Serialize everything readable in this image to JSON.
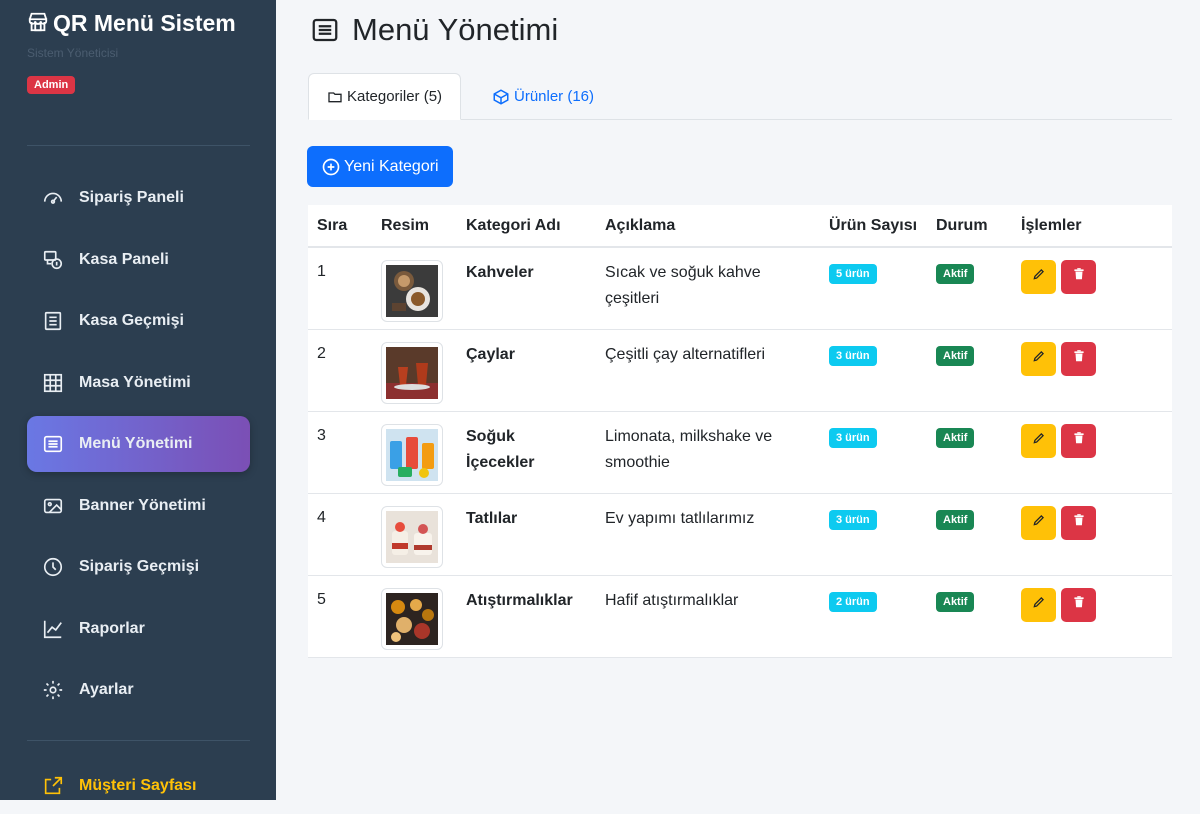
{
  "brand": {
    "title": "QR Menü Sistem",
    "subtitle": "Sistem Yöneticisi",
    "role_badge": "Admin"
  },
  "nav": [
    {
      "label": "Sipariş Paneli",
      "icon": "speedometer-icon"
    },
    {
      "label": "Kasa Paneli",
      "icon": "cash-register-icon"
    },
    {
      "label": "Kasa Geçmişi",
      "icon": "receipt-icon"
    },
    {
      "label": "Masa Yönetimi",
      "icon": "grid-icon"
    },
    {
      "label": "Menü Yönetimi",
      "icon": "list-icon",
      "active": true
    },
    {
      "label": "Banner Yönetimi",
      "icon": "image-icon"
    },
    {
      "label": "Sipariş Geçmişi",
      "icon": "clock-icon"
    },
    {
      "label": "Raporlar",
      "icon": "chart-line-icon"
    },
    {
      "label": "Ayarlar",
      "icon": "gear-icon"
    }
  ],
  "customer_link": {
    "label": "Müşteri Sayfası",
    "icon": "external-link-icon"
  },
  "page": {
    "title": "Menü Yönetimi"
  },
  "tabs": [
    {
      "label": "Kategoriler (5)",
      "icon": "folder-icon",
      "active": true
    },
    {
      "label": "Ürünler (16)",
      "icon": "box-icon",
      "active": false
    }
  ],
  "new_category_button": "Yeni Kategori",
  "table": {
    "headers": [
      "Sıra",
      "Resim",
      "Kategori Adı",
      "Açıklama",
      "Ürün Sayısı",
      "Durum",
      "İşlemler"
    ],
    "rows": [
      {
        "order": "1",
        "name": "Kahveler",
        "description": "Sıcak ve soğuk kahve çeşitleri",
        "count": "5 ürün",
        "status": "Aktif"
      },
      {
        "order": "2",
        "name": "Çaylar",
        "description": "Çeşitli çay alternatifleri",
        "count": "3 ürün",
        "status": "Aktif"
      },
      {
        "order": "3",
        "name": "Soğuk İçecekler",
        "description": "Limonata, milkshake ve smoothie",
        "count": "3 ürün",
        "status": "Aktif"
      },
      {
        "order": "4",
        "name": "Tatlılar",
        "description": "Ev yapımı tatlılarımız",
        "count": "3 ürün",
        "status": "Aktif"
      },
      {
        "order": "5",
        "name": "Atıştırmalıklar",
        "description": "Hafif atıştırmalıklar",
        "count": "2 ürün",
        "status": "Aktif"
      }
    ]
  },
  "colors": {
    "sidebar": "#2c3e50",
    "primary": "#0d6efd",
    "info": "#0dcaf0",
    "success": "#198754",
    "warning": "#ffc107",
    "danger": "#dc3545"
  }
}
